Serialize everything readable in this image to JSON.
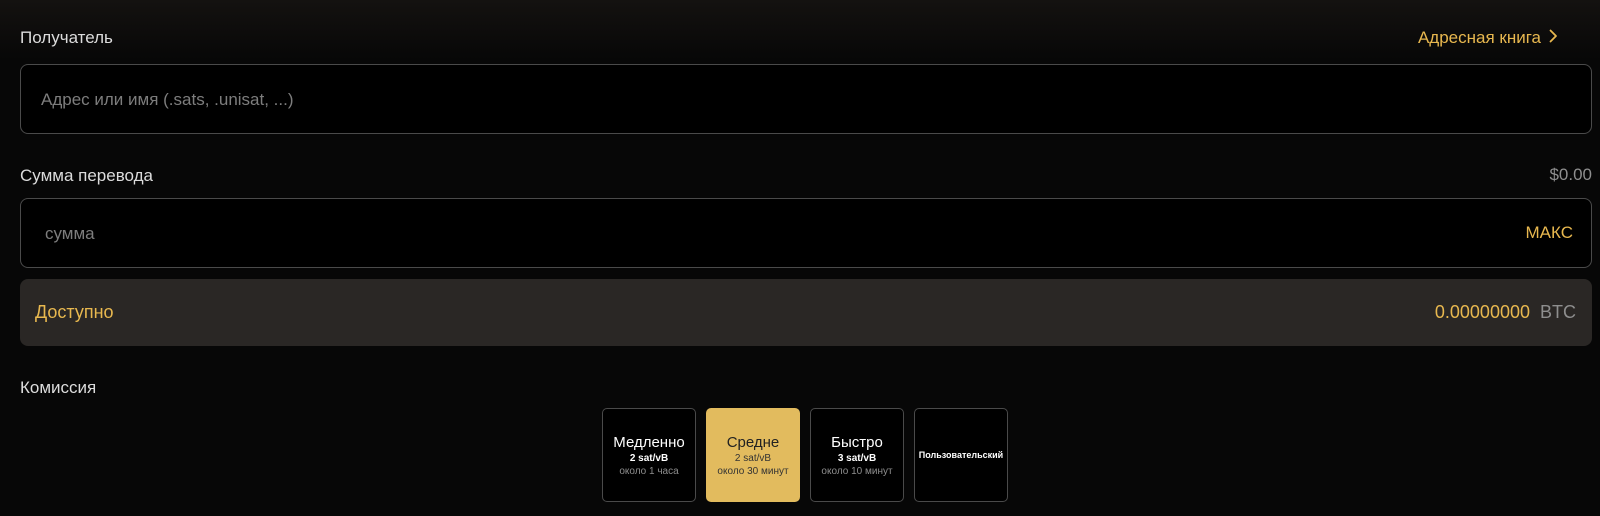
{
  "recipient": {
    "label": "Получатель",
    "address_book_label": "Адресная книга",
    "input_placeholder": "Адрес или имя (.sats, .unisat, ...)",
    "input_value": ""
  },
  "amount": {
    "label": "Сумма перевода",
    "usd_value": "$0.00",
    "input_placeholder": "сумма",
    "input_value": "",
    "max_label": "МАКС"
  },
  "available": {
    "label": "Доступно",
    "amount": "0.00000000",
    "unit": "BTC"
  },
  "fee": {
    "label": "Комиссия",
    "options": [
      {
        "title": "Медленно",
        "rate": "2 sat/vB",
        "time": "около 1 часа",
        "selected": false
      },
      {
        "title": "Средне",
        "rate": "2 sat/vB",
        "time": "около 30 минут",
        "selected": true
      },
      {
        "title": "Быстро",
        "rate": "3 sat/vB",
        "time": "около 10 минут",
        "selected": false
      },
      {
        "title": "Пользовательский",
        "selected": false
      }
    ]
  },
  "colors": {
    "accent": "#e8b84f",
    "selected_fee_bg": "#e2bb5e",
    "available_bg": "#2a2725"
  },
  "icons": {
    "address_book_arrow": "chevron-right-icon"
  }
}
